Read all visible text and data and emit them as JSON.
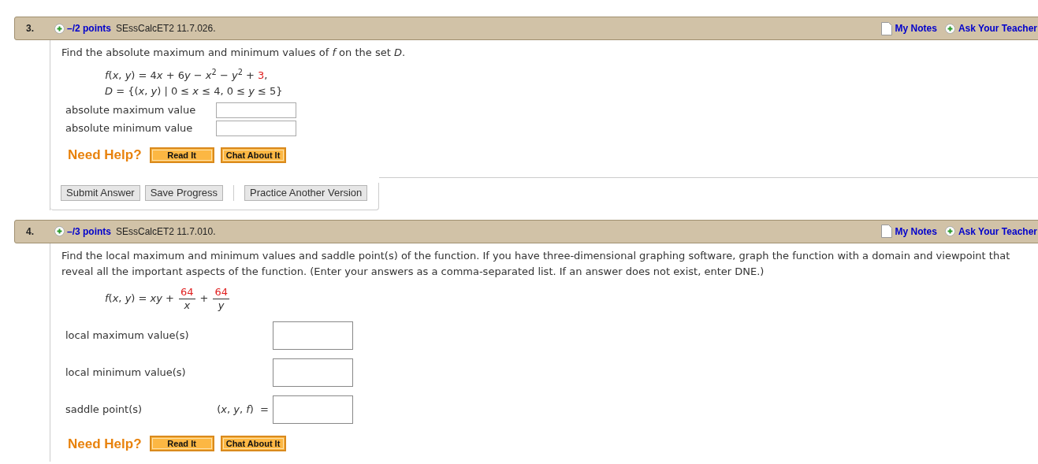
{
  "questions": [
    {
      "number": "3.",
      "points": "–/2 points",
      "source": "SEssCalcET2 11.7.026.",
      "notes_link": "My Notes",
      "ask_link": "Ask Your Teacher",
      "prompt": "Find the absolute maximum and minimum values of *f* on the set *D*.",
      "formula": {
        "kind": "lines",
        "lines": [
          [
            {
              "text": "*f*(*x*, *y*) = 4",
              "highlighted": false
            },
            {
              "text": "*x* + 6",
              "highlighted": false
            },
            {
              "text": "*y* − *x*$^{2}$ − *y*$^{2}$ + ",
              "highlighted": false
            },
            {
              "text": "3",
              "highlighted": true
            },
            {
              "text": ",",
              "highlighted": false
            }
          ],
          [
            {
              "text": "*D* = {(*x*, *y*) | 0 ≤ *x* ≤ 4, 0 ≤ *y* ≤ 5}",
              "highlighted": false
            }
          ]
        ]
      },
      "answers": [
        {
          "kind": "compact",
          "label": "absolute maximum value"
        },
        {
          "kind": "compact",
          "label": "absolute minimum value"
        }
      ],
      "help": {
        "label": "Need Help?",
        "buttons": [
          "Read It",
          "Chat About It"
        ]
      },
      "actions": [
        [
          "Submit Answer",
          "Save Progress"
        ],
        [
          "Practice Another Version"
        ]
      ]
    },
    {
      "number": "4.",
      "points": "–/3 points",
      "source": "SEssCalcET2 11.7.010.",
      "notes_link": "My Notes",
      "ask_link": "Ask Your Teacher",
      "prompt": "Find the local maximum and minimum values and saddle point(s) of the function. If you have three-dimensional graphing software, graph the function with a domain and viewpoint that reveal all the important aspects of the function. (Enter your answers as a comma-separated list. If an answer does not exist, enter DNE.)",
      "formula": {
        "kind": "fraction",
        "lead": "*f*(*x*, *y*) = *xy* +",
        "terms": [
          {
            "numerator": "64",
            "denominator": "*x*"
          },
          {
            "numerator": "64",
            "denominator": "*y*"
          }
        ],
        "joiner": "+"
      },
      "answers": [
        {
          "kind": "spaced",
          "label": "local maximum value(s)"
        },
        {
          "kind": "spaced",
          "label": "local minimum value(s)"
        },
        {
          "kind": "spaced",
          "label": "saddle point(s)",
          "prefix": "(*x*, *y*, *f*)  ="
        }
      ],
      "help": {
        "label": "Need Help?",
        "buttons": [
          "Read It",
          "Chat About It"
        ]
      }
    }
  ]
}
